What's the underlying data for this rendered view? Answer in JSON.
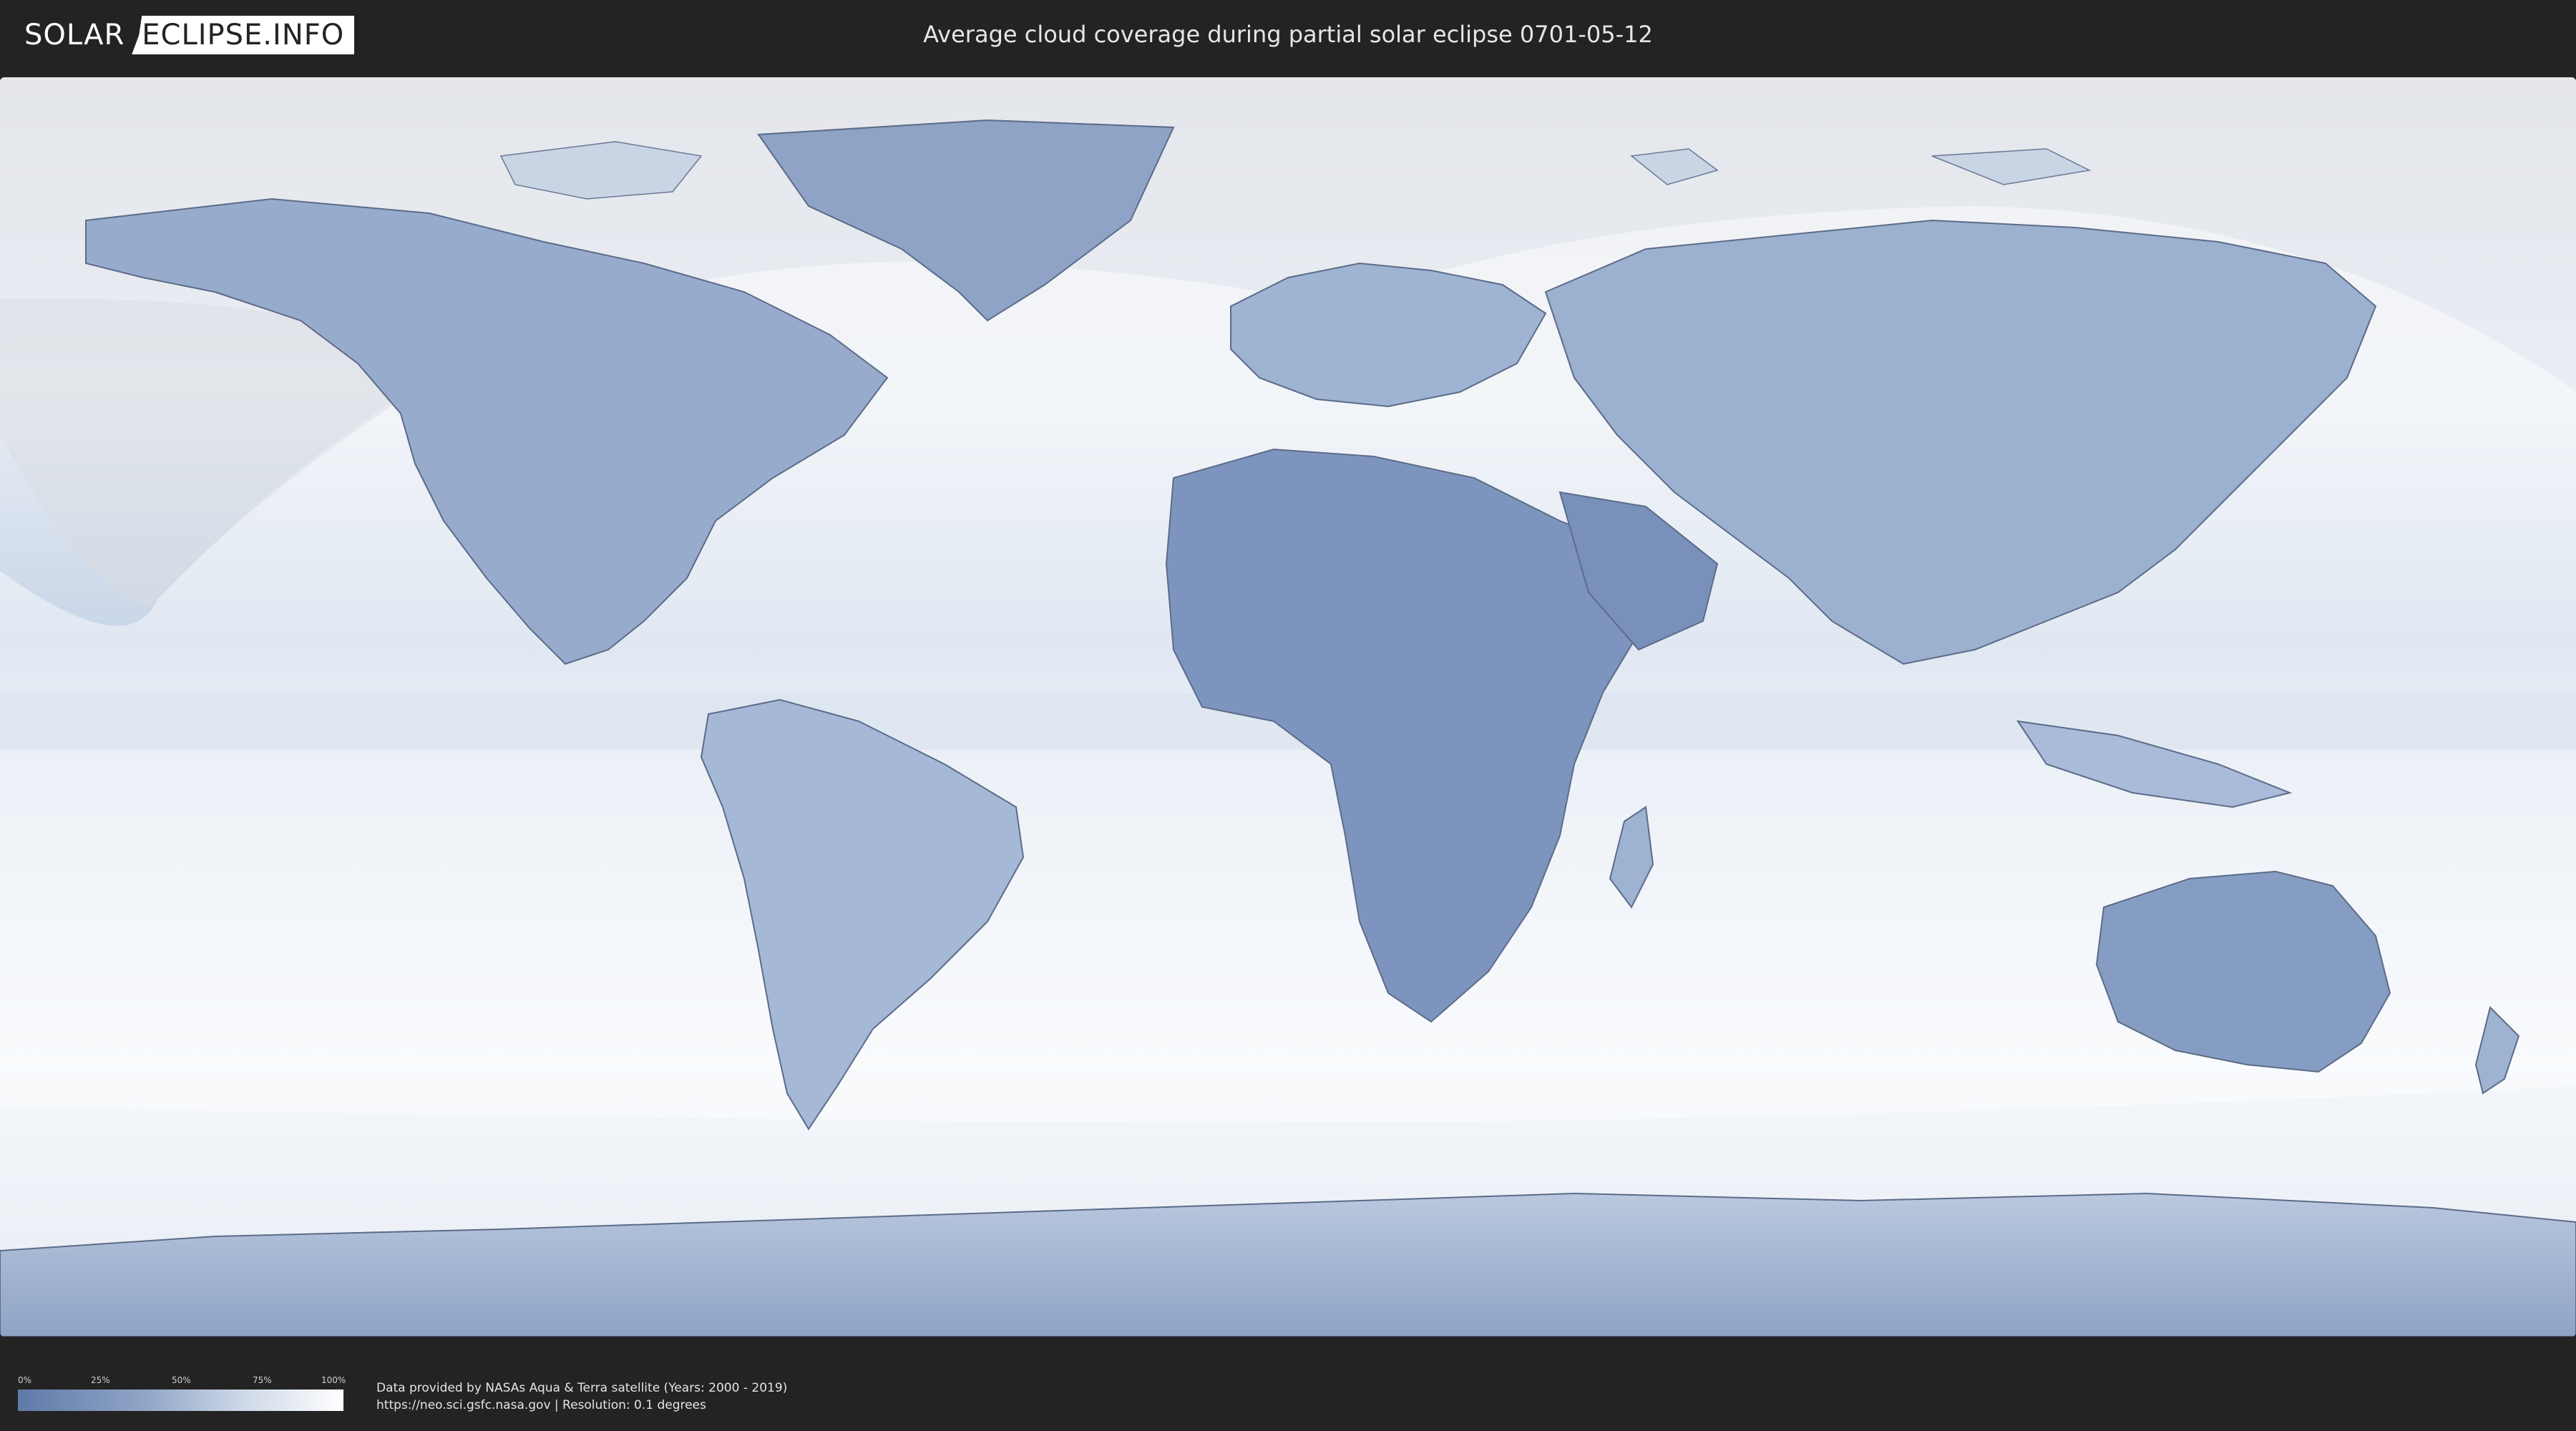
{
  "header": {
    "logo_left": "SOLAR",
    "logo_right": "ECLIPSE.INFO",
    "title": "Average cloud coverage during partial solar eclipse 0701-05-12"
  },
  "map": {
    "ocean_color": "#dce6f2",
    "land_color": "#7d95be",
    "ice_color": "#eef2f7",
    "eclipse_zone_color": "#ffffff",
    "outline_color": "#4b5a78"
  },
  "legend": {
    "ticks": [
      "0%",
      "25%",
      "50%",
      "75%",
      "100%"
    ],
    "gradient": [
      "#5f7aa8",
      "#92a7c8",
      "#cfd9e8",
      "#ffffff"
    ]
  },
  "credits": {
    "line1": "Data provided by NASAs Aqua & Terra satellite (Years: 2000 - 2019)",
    "line2": "https://neo.sci.gsfc.nasa.gov | Resolution: 0.1 degrees"
  }
}
